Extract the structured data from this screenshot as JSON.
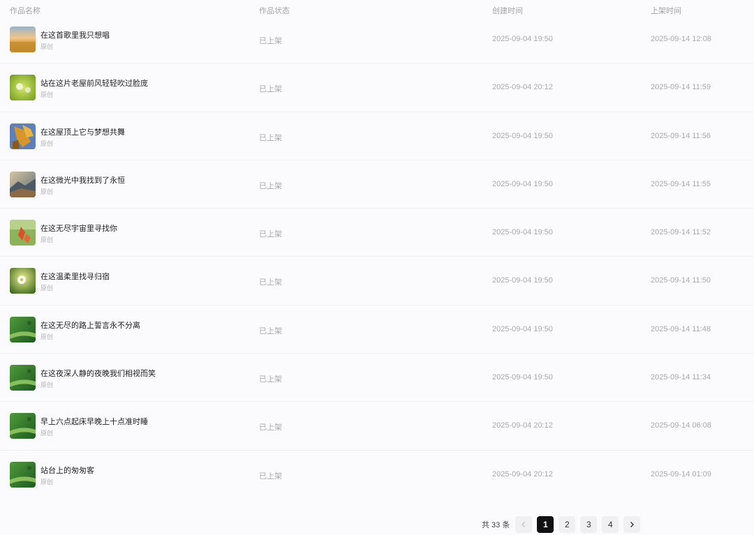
{
  "table": {
    "headers": {
      "name": "作品名称",
      "status": "作品状态",
      "created": "创建时间",
      "listed": "上架时间"
    },
    "rows": [
      {
        "title": "在这首歌里我只想唱",
        "subtitle": "原创",
        "status": "已上架",
        "created": "2025-09-04 19:50",
        "listed": "2025-09-14 12:08",
        "thumb": "sunset-field-image"
      },
      {
        "title": "站在这片老屋前风轻轻吹过脸庞",
        "subtitle": "原创",
        "status": "已上架",
        "created": "2025-09-04 20:12",
        "listed": "2025-09-14 11:59",
        "thumb": "dandelion-image"
      },
      {
        "title": "在这屋顶上它与梦想共舞",
        "subtitle": "原创",
        "status": "已上架",
        "created": "2025-09-04 19:50",
        "listed": "2025-09-14 11:56",
        "thumb": "autumn-leaves-image"
      },
      {
        "title": "在这微光中我找到了永恒",
        "subtitle": "原创",
        "status": "已上架",
        "created": "2025-09-04 19:50",
        "listed": "2025-09-14 11:55",
        "thumb": "landscape-image"
      },
      {
        "title": "在这无尽宇宙里寻找你",
        "subtitle": "原创",
        "status": "已上架",
        "created": "2025-09-04 19:50",
        "listed": "2025-09-14 11:52",
        "thumb": "red-flower-image"
      },
      {
        "title": "在这温柔里找寻归宿",
        "subtitle": "原创",
        "status": "已上架",
        "created": "2025-09-04 19:50",
        "listed": "2025-09-14 11:50",
        "thumb": "white-flower-image"
      },
      {
        "title": "在这无尽的路上誓言永不分离",
        "subtitle": "原创",
        "status": "已上架",
        "created": "2025-09-04 19:50",
        "listed": "2025-09-14 11:48",
        "thumb": "green-leaf-image"
      },
      {
        "title": "在这夜深人静的夜晚我们相视而笑",
        "subtitle": "原创",
        "status": "已上架",
        "created": "2025-09-04 19:50",
        "listed": "2025-09-14 11:34",
        "thumb": "green-leaf-image"
      },
      {
        "title": "早上六点起床早晚上十点准时睡",
        "subtitle": "原创",
        "status": "已上架",
        "created": "2025-09-04 20:12",
        "listed": "2025-09-14 06:08",
        "thumb": "green-leaf-image"
      },
      {
        "title": "站台上的匆匆客",
        "subtitle": "原创",
        "status": "已上架",
        "created": "2025-09-04 20:12",
        "listed": "2025-09-14 01:09",
        "thumb": "green-leaf-image"
      }
    ]
  },
  "pagination": {
    "total": "共 33 条",
    "pages": [
      "1",
      "2",
      "3",
      "4"
    ],
    "current": "1",
    "prev_icon": "chevron-left-icon",
    "next_icon": "chevron-right-icon"
  },
  "colors": {
    "background": "#fbfbfd",
    "active_page": "#111114",
    "muted_text": "#a9a9ae"
  }
}
